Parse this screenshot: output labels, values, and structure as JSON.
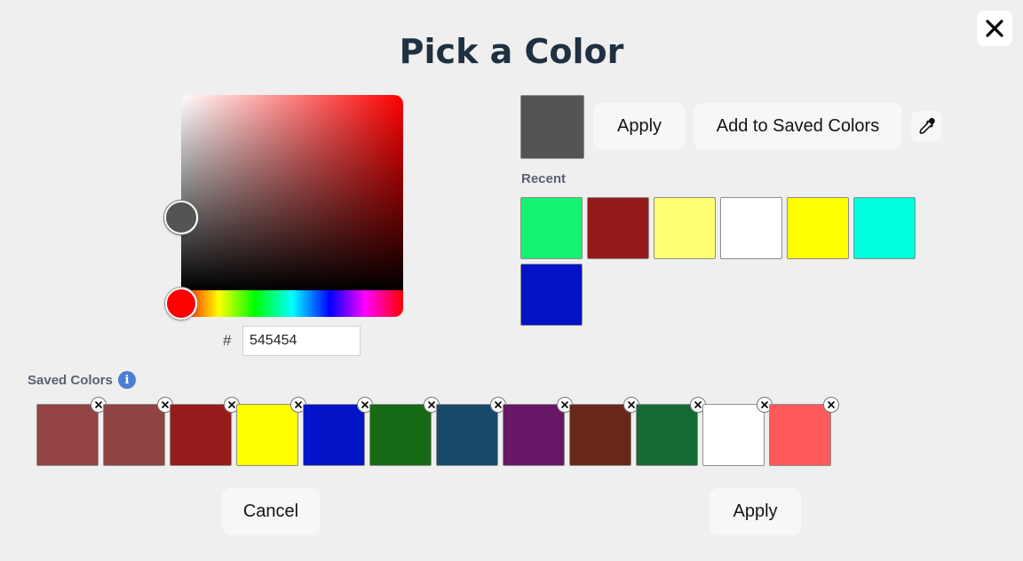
{
  "dialog": {
    "title": "Pick a Color",
    "close_icon": "close-icon"
  },
  "picker": {
    "hue_color": "#ff0000",
    "current_color": "#545454",
    "hex_prefix": "#",
    "hex_value": "545454"
  },
  "actions": {
    "apply_label": "Apply",
    "add_saved_label": "Add to Saved Colors",
    "eyedropper_icon": "eyedropper-icon"
  },
  "recent": {
    "label": "Recent",
    "colors": [
      "#14f26f",
      "#951b1b",
      "#ffff73",
      "#ffffff",
      "#ffff00",
      "#00ffdd",
      "#0213c8"
    ]
  },
  "saved": {
    "label": "Saved Colors",
    "info_icon": "info-icon",
    "info_glyph": "i",
    "remove_icon": "remove-icon",
    "colors": [
      "#934343",
      "#8f4343",
      "#961c1c",
      "#ffff00",
      "#0213c8",
      "#176a15",
      "#164a68",
      "#681766",
      "#682817",
      "#166b35",
      "#ffffff",
      "#ff5a5a"
    ]
  },
  "footer": {
    "cancel_label": "Cancel",
    "apply_label": "Apply"
  }
}
